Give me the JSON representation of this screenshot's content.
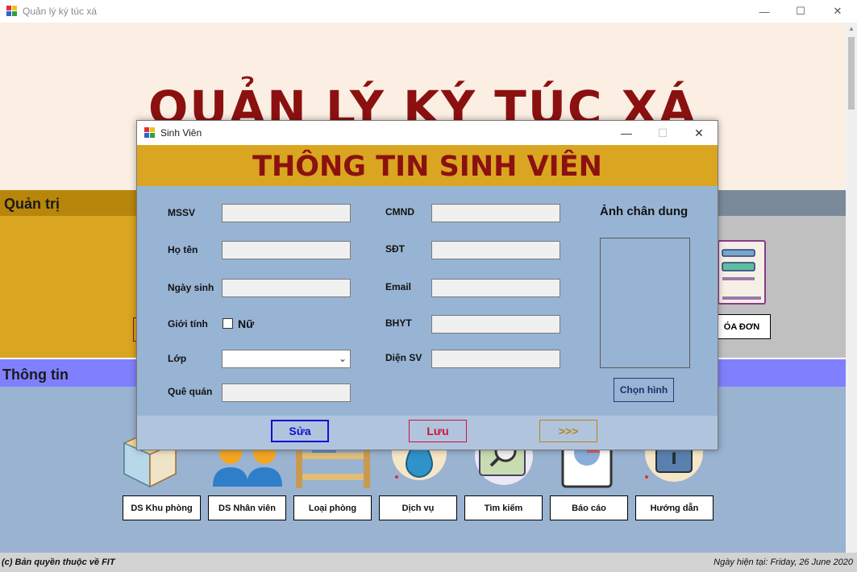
{
  "main_window": {
    "title": "Quản lý ký túc xá",
    "controls": {
      "minimize": "—",
      "maximize": "☐",
      "close": "✕"
    },
    "heading": "QUẢN LÝ KÝ TÚC XÁ",
    "admin_section": {
      "title": "Quản trị",
      "invoice_button": "ÓA ĐƠN"
    },
    "info_section": {
      "title": "Thông tin",
      "tiles": [
        {
          "label": "DS Khu phòng",
          "icon": "building-icon"
        },
        {
          "label": "DS Nhân viên",
          "icon": "people-icon"
        },
        {
          "label": "Loại phòng",
          "icon": "bunk-bed-icon"
        },
        {
          "label": "Dịch vụ",
          "icon": "water-drop-icon"
        },
        {
          "label": "Tìm kiếm",
          "icon": "magnifier-icon"
        },
        {
          "label": "Báo cáo",
          "icon": "pie-chart-report-icon"
        },
        {
          "label": "Hướng dẫn",
          "icon": "manual-book-icon"
        }
      ]
    },
    "status_bar": {
      "copyright": "(c) Bản quyền thuộc về FIT",
      "date": "Ngày hiện tại: Friday, 26 June 2020"
    }
  },
  "dialog": {
    "title": "Sinh Viên",
    "controls": {
      "minimize": "—",
      "maximize": "☐",
      "close": "✕"
    },
    "heading": "THÔNG TIN SINH VIÊN",
    "fields": {
      "mssv": {
        "label": "MSSV",
        "value": ""
      },
      "ho_ten": {
        "label": "Họ tên",
        "value": ""
      },
      "ngay_sinh": {
        "label": "Ngày sinh",
        "value": ""
      },
      "gioi_tinh": {
        "label": "Giới tính",
        "option": "Nữ",
        "checked": false
      },
      "lop": {
        "label": "Lớp",
        "value": ""
      },
      "que_quan": {
        "label": "Quê quán",
        "value": ""
      },
      "cmnd": {
        "label": "CMND",
        "value": ""
      },
      "sdt": {
        "label": "SĐT",
        "value": ""
      },
      "email": {
        "label": "Email",
        "value": ""
      },
      "bhyt": {
        "label": "BHYT",
        "value": ""
      },
      "dien_sv": {
        "label": "Diện SV",
        "value": ""
      }
    },
    "photo": {
      "label": "Ảnh chân dung",
      "button": "Chọn hình"
    },
    "footer": {
      "edit": "Sửa",
      "save": "Lưu",
      "next": ">>>"
    }
  },
  "colors": {
    "heading_red": "#8b1111",
    "gold": "#daa520",
    "dark_gold": "#b8860b",
    "steel_blue": "#99b3d1",
    "info_header": "#8080ff"
  }
}
